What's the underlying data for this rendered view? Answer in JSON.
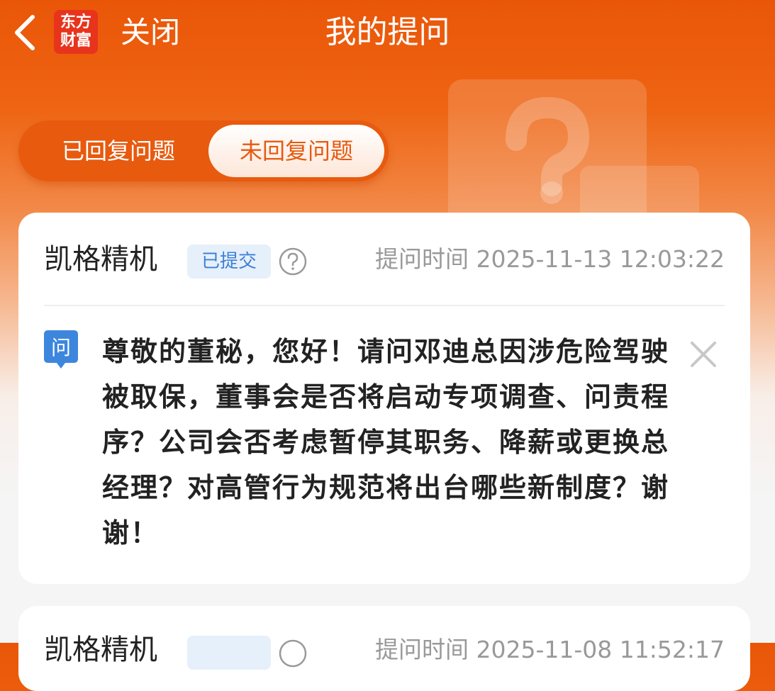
{
  "header": {
    "logo_line1": "东方",
    "logo_line2": "财富",
    "close_label": "关闭",
    "title": "我的提问"
  },
  "tabs": {
    "replied": "已回复问题",
    "unreplied": "未回复问题",
    "active": "unreplied"
  },
  "questions": [
    {
      "company": "凯格精机",
      "status": "已提交",
      "time_label": "提问时间 2025-11-13 12:03:22",
      "question_badge": "问",
      "text": "尊敬的董秘，您好！请问邓迪总因涉危险驾驶被取保，董事会是否将启动专项调查、问责程序？公司会否考虑暂停其职务、降薪或更换总经理？对高管行为规范将出台哪些新制度？谢谢！"
    },
    {
      "company": "凯格精机",
      "time_label": "提问时间 2025-11-08 11:52:17"
    }
  ],
  "colors": {
    "brand_orange": "#ea5608",
    "logo_red": "#e8341c",
    "badge_blue": "#3d7fd6",
    "badge_bg": "#e6f0fb"
  },
  "icons": [
    "back-arrow-icon",
    "help-circle-icon",
    "question-badge-icon",
    "close-icon"
  ]
}
